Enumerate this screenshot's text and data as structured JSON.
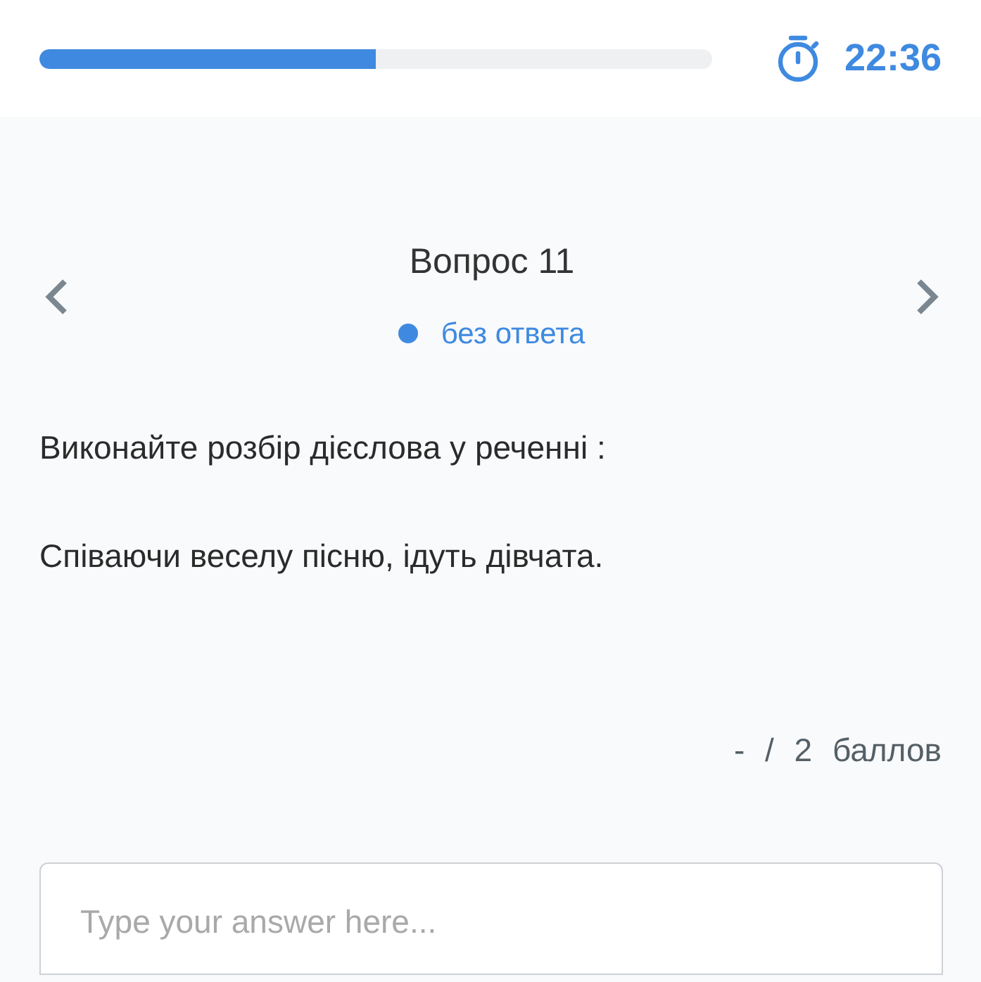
{
  "progress": {
    "level": 0.5
  },
  "timer": {
    "time": "22:36"
  },
  "question": {
    "title": "Вопрос 11",
    "status": {
      "text": "без ответа",
      "color": "#3f8ae0"
    }
  },
  "prompt": "Виконайте розбір дієслова у реченні :",
  "sentence": "Співаючи веселу пісню, ідуть дівчата.",
  "score": "- / 2 баллов",
  "answer": {
    "placeholder": "Type your answer here..."
  }
}
